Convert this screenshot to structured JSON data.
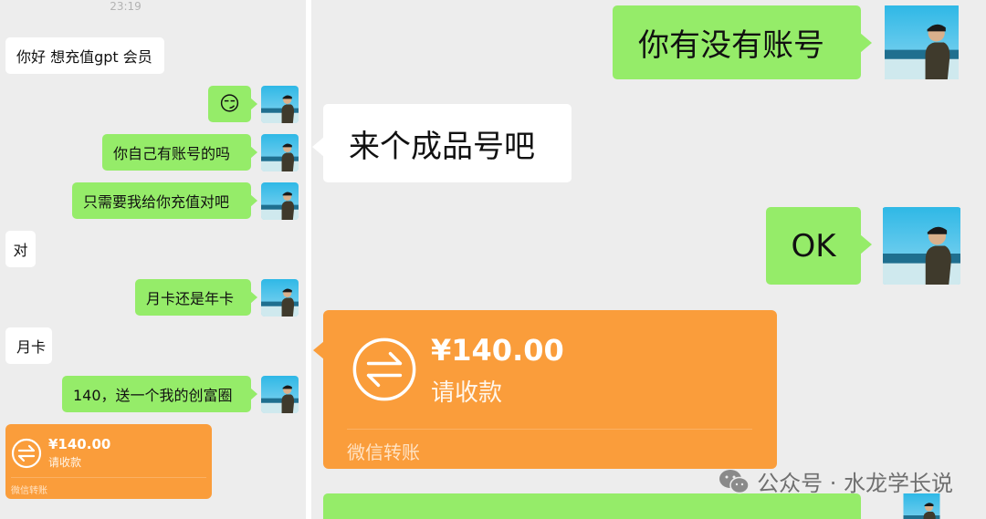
{
  "left_chat": {
    "timestamp": "23:19",
    "messages": [
      {
        "text": "你好 想充值gpt 会员"
      },
      {
        "emoji": "😏"
      },
      {
        "text": "你自己有账号的吗"
      },
      {
        "text": "只需要我给你充值对吧"
      },
      {
        "text": "对"
      },
      {
        "text": "月卡还是年卡"
      },
      {
        "text": "月卡"
      },
      {
        "text": "140，送一个我的创富圈"
      }
    ],
    "transfer": {
      "amount": "¥140.00",
      "status": "请收款",
      "footer": "微信转账"
    }
  },
  "right_chat": {
    "messages": [
      {
        "text": "你有没有账号"
      },
      {
        "text": "来个成品号吧"
      },
      {
        "text": "OK"
      }
    ],
    "transfer": {
      "amount": "¥140.00",
      "status": "请收款",
      "footer": "微信转账"
    }
  },
  "watermark": {
    "text": "公众号 · 水龙学长说",
    "icon": "wechat-icon"
  },
  "colors": {
    "self_bubble": "#95ec69",
    "other_bubble": "#ffffff",
    "transfer": "#fa9d3b",
    "chat_bg": "#ededed"
  }
}
